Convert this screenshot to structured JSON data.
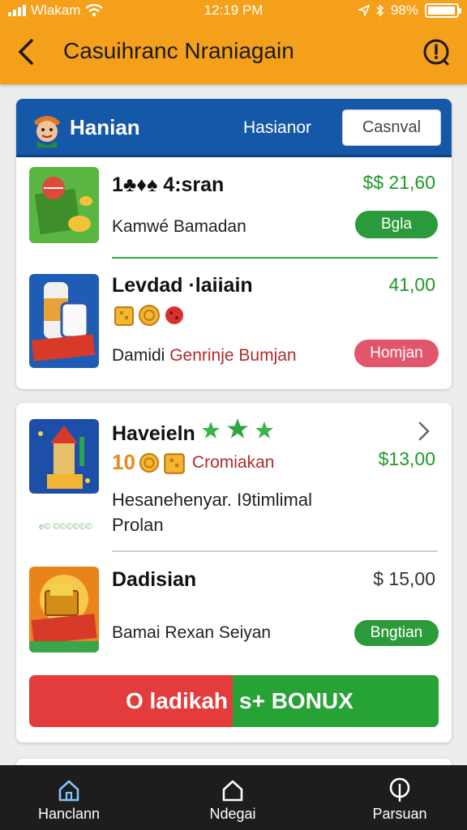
{
  "status": {
    "carrier": "Wlakam",
    "time": "12:19 PM",
    "battery": "98%",
    "battery_level": 0.98
  },
  "header": {
    "title": "Casuihranc Nraniagain"
  },
  "card1": {
    "head": {
      "title": "Hanian",
      "subtitle": "Hasianor",
      "button": "Casnval"
    },
    "items": [
      {
        "title": "1♣♦♠ 4:sran",
        "price": "$$ 21,60",
        "subtitle": "Kamwé Bamadan",
        "pill": "Bgla"
      },
      {
        "title": "Levdad ·laiiain",
        "price": "41,00",
        "subtitle_a": "Damidi",
        "subtitle_b": "Genrinje Bumjan",
        "pill": "Homjan"
      }
    ]
  },
  "card2": {
    "items": [
      {
        "title": "Haveieln",
        "price": "$13,00",
        "badge_text": "10",
        "tag": "Cromiakan",
        "desc_line1": "Hesanehenyar. I9timlimal",
        "desc_line2": "Prolan",
        "caption": "e© ©©©©©©"
      },
      {
        "title": "Dadisian",
        "price": "$ 15,00",
        "subtitle": "Bamai Rexan Seiyan",
        "pill": "Bngtian"
      }
    ],
    "bonus": {
      "left": "O ladikah",
      "right": "s+ BONUX"
    }
  },
  "nav": [
    {
      "label": "Hanclann",
      "icon": "home-icon"
    },
    {
      "label": "Ndegai",
      "icon": "house-icon"
    },
    {
      "label": "Parsuan",
      "icon": "profile-icon"
    }
  ],
  "colors": {
    "header": "#f5a01a",
    "card_head": "#1658a8",
    "green": "#2a9a3a",
    "pink": "#e2566c",
    "bonus_red": "#e43c3c",
    "bonus_green": "#27a235",
    "nav": "#1d1d1d"
  }
}
